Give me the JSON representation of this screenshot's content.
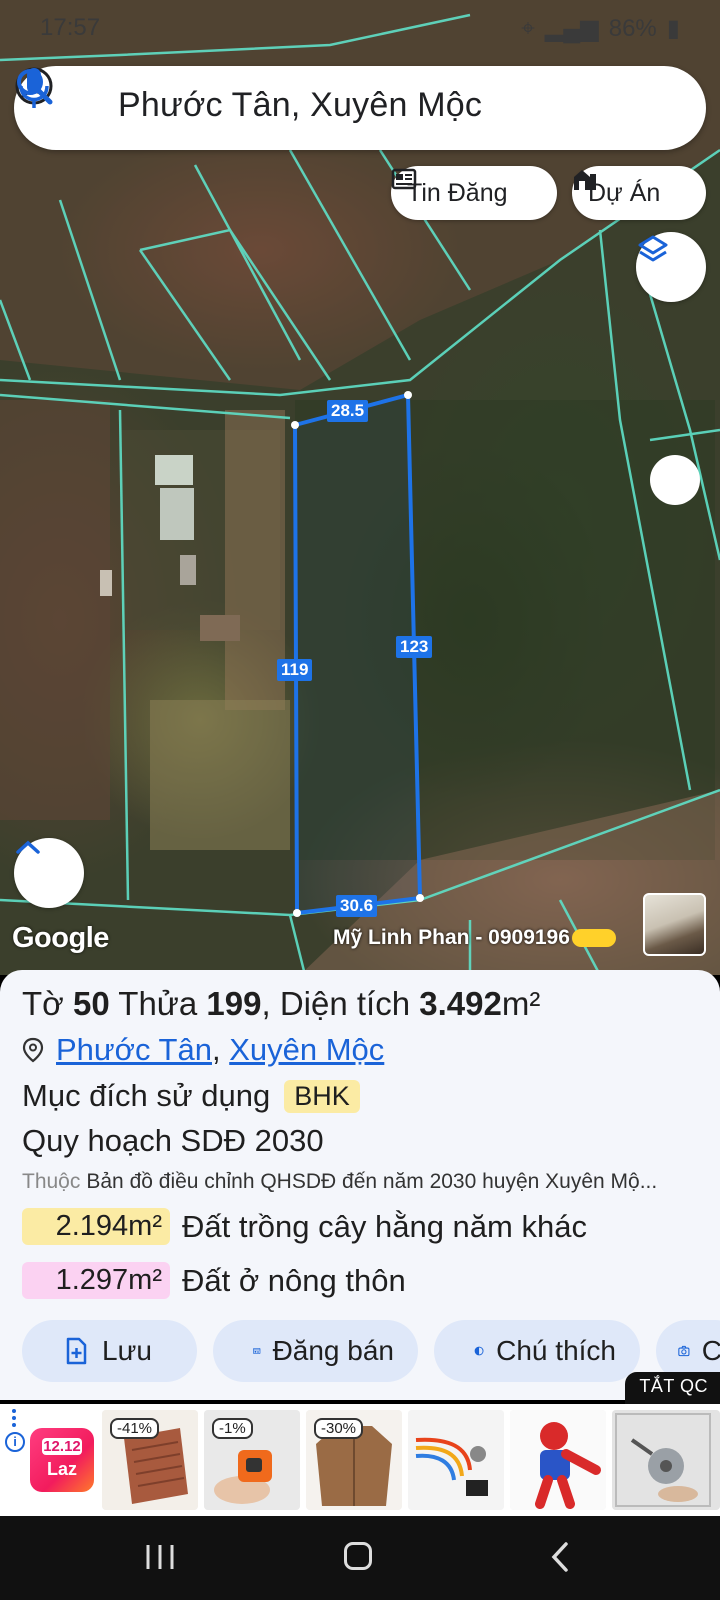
{
  "status_bar": {
    "time": "17:57",
    "battery": "86%"
  },
  "search": {
    "text": "Phước Tân, Xuyên Mộc"
  },
  "chips": {
    "news_label": "Tin Đăng",
    "project_label": "Dự Án"
  },
  "map": {
    "dimensions": {
      "top": "28.5",
      "right": "123",
      "left": "119",
      "bottom": "30.6"
    },
    "google_logo": "Google",
    "agent": "Mỹ Linh Phan - 0909196"
  },
  "parcel": {
    "sheet_label": "Tờ",
    "sheet_no": "50",
    "plot_label": "Thửa",
    "plot_no": "199",
    "area_label": ", Diện tích",
    "area_value": "3.492",
    "area_unit": "m²",
    "ward": "Phước Tân",
    "separator": ",",
    "district": "Xuyên Mộc",
    "purpose_label": "Mục đích sử dụng",
    "purpose_code": "BHK",
    "plan_label": "Quy hoạch SDĐ 2030",
    "belongs_prefix": "Thuộc",
    "belongs_text": "Bản đồ điều chỉnh QHSDĐ đến năm 2030 huyện Xuyên Mộ...",
    "areas": [
      {
        "value": "2.194m²",
        "label": "Đất trồng cây hằng năm khác",
        "color": "#fbeba4"
      },
      {
        "value": "1.297m²",
        "label": "Đất ở nông thôn",
        "color": "#fbd2f2"
      }
    ]
  },
  "actions": {
    "save": "Lưu",
    "sell": "Đăng bán",
    "legend": "Chú thích",
    "camera": "C"
  },
  "ad": {
    "close_label": "TẮT QC",
    "logo_line1": "12.12",
    "logo_line2": "Laz",
    "discounts": [
      "-41%",
      "-1%",
      "-30%"
    ]
  },
  "colors": {
    "parcel_outline": "#1e73e8",
    "plot_lines": "#5fe0c8",
    "link": "#1a63d8",
    "action_bg": "#dfe8f9"
  }
}
